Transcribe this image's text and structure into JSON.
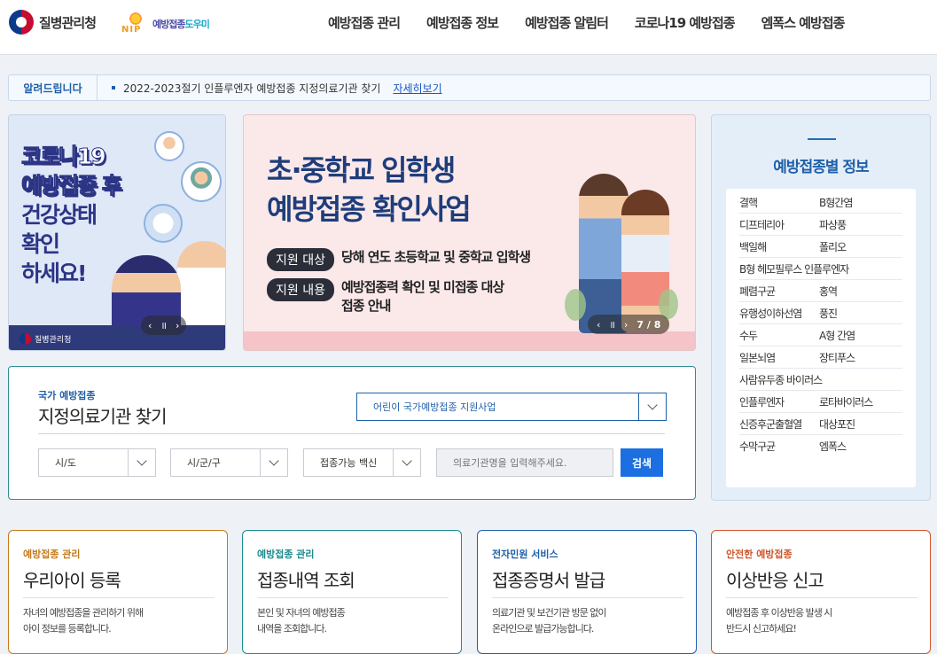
{
  "header": {
    "org_name": "질병관리청",
    "service_name_a": "예방접종",
    "service_name_b": "도우미",
    "service_mark_text": "NIP",
    "nav": [
      "예방접종 관리",
      "예방접종 정보",
      "예방접종 알림터",
      "코로나19 예방접종",
      "엠폭스 예방접종"
    ]
  },
  "notice": {
    "label": "알려드립니다",
    "text": "2022-2023절기 인플루엔자 예방접종 지정의료기관 찾기",
    "link": "자세히보기"
  },
  "banner_left": {
    "line1": "코로나19",
    "line2": "예방접종 후",
    "line3": "건강상태",
    "line4": "확인",
    "line5": "하세요!",
    "org": "질병관리청",
    "prev": "‹",
    "pause": "॥",
    "next": "›"
  },
  "banner_main": {
    "title_line1": "초·중학교 입학생",
    "title_line2": "예방접종 확인사업",
    "row1_pill": "지원 대상",
    "row1_text": "당해 연도 초등학교 및 중학교 입학생",
    "row2_pill": "지원 내용",
    "row2_text_line1": "예방접종력 확인 및 미접종 대상",
    "row2_text_line2": "접종 안내",
    "prev": "‹",
    "pause": "॥",
    "next": "›",
    "counter": "7 / 8"
  },
  "side_info": {
    "title": "예방접종별 정보",
    "rows": [
      [
        "결핵",
        "B형간염"
      ],
      [
        "디프테리아",
        "파상풍"
      ],
      [
        "백일해",
        "폴리오"
      ],
      [
        "B형 헤모필루스 인플루엔자",
        ""
      ],
      [
        "폐렴구균",
        "홍역"
      ],
      [
        "유행성이하선염",
        "풍진"
      ],
      [
        "수두",
        "A형 간염"
      ],
      [
        "일본뇌염",
        "장티푸스"
      ],
      [
        "사람유두종 바이러스",
        ""
      ],
      [
        "인플루엔자",
        "로타바이러스"
      ],
      [
        "신증후군출혈열",
        "대상포진"
      ],
      [
        "수막구균",
        "엠폭스"
      ]
    ]
  },
  "search": {
    "small_label": "국가 예방접종",
    "title": "지정의료기관 찾기",
    "program_select": "어린이 국가예방접종 지원사업",
    "sido": "시/도",
    "sigungu": "시/군/구",
    "vaccine": "접종가능 백신",
    "input_placeholder": "의료기관명을 입력해주세요.",
    "button": "검색"
  },
  "cards": [
    {
      "kicker": "예방접종 관리",
      "title": "우리아이 등록",
      "desc1": "자녀의 예방접종을 관리하기 위해",
      "desc2": "아이 정보를 등록합니다.",
      "color": "#c47a1a"
    },
    {
      "kicker": "예방접종 관리",
      "title": "접종내역 조회",
      "desc1": "본인 및 자녀의 예방접종",
      "desc2": "내역을 조회합니다.",
      "color": "#1d8a8d"
    },
    {
      "kicker": "전자민원 서비스",
      "title": "접종증명서 발급",
      "desc1": "의료기관 및 보건기관 방문 없이",
      "desc2": "온라인으로 발급가능합니다.",
      "color": "#1f5fa8"
    },
    {
      "kicker": "안전한 예방접종",
      "title": "이상반응 신고",
      "desc1": "예방접종 후 이상반응 발생 시",
      "desc2": "반드시 신고하세요!",
      "color": "#d0552a"
    }
  ]
}
